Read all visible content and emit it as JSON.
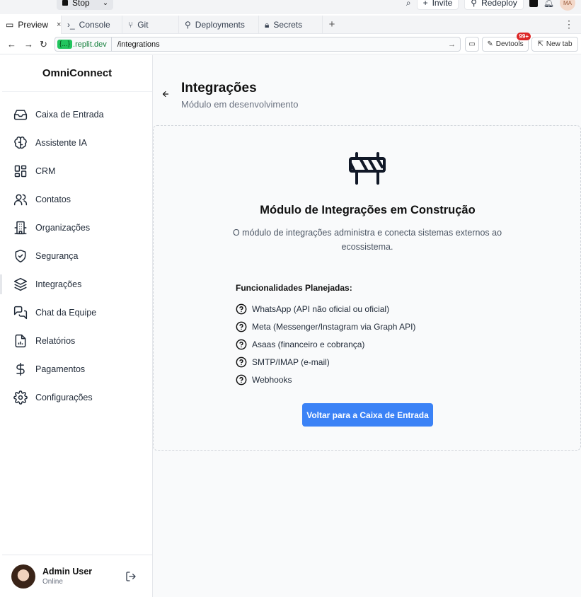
{
  "replit": {
    "stop_label": "Stop",
    "invite_label": "Invite",
    "redeploy_label": "Redeploy",
    "avatar_initials": "MA"
  },
  "tabs": [
    {
      "label": "Preview",
      "icon": "monitor-icon"
    },
    {
      "label": "Console",
      "icon": "terminal-icon"
    },
    {
      "label": "Git",
      "icon": "git-icon"
    },
    {
      "label": "Deployments",
      "icon": "deploy-icon"
    },
    {
      "label": "Secrets",
      "icon": "lock-icon"
    }
  ],
  "urlbar": {
    "domain_badge": "{...}",
    "domain": ".replit.dev",
    "path": "/integrations",
    "devtools_label": "Devtools",
    "devtools_badge": "99+",
    "newtab_label": "New tab"
  },
  "sidebar": {
    "brand": "OmniConnect",
    "items": [
      {
        "label": "Caixa de Entrada",
        "icon": "inbox-icon"
      },
      {
        "label": "Assistente IA",
        "icon": "brain-icon"
      },
      {
        "label": "CRM",
        "icon": "layout-grid-icon"
      },
      {
        "label": "Contatos",
        "icon": "users-icon"
      },
      {
        "label": "Organizações",
        "icon": "building-icon"
      },
      {
        "label": "Segurança",
        "icon": "shield-check-icon"
      },
      {
        "label": "Integrações",
        "icon": "layers-icon"
      },
      {
        "label": "Chat da Equipe",
        "icon": "messages-icon"
      },
      {
        "label": "Relatórios",
        "icon": "report-icon"
      },
      {
        "label": "Pagamentos",
        "icon": "dollar-icon"
      },
      {
        "label": "Configurações",
        "icon": "settings-icon"
      }
    ],
    "active_index": 6,
    "user": {
      "name": "Admin User",
      "status": "Online"
    }
  },
  "main": {
    "title": "Integrações",
    "subtitle": "Módulo em desenvolvimento",
    "card": {
      "icon": "construction-icon",
      "title": "Módulo de Integrações em Construção",
      "description": "O módulo de integrações administra e conecta sistemas externos ao ecossistema.",
      "features_title": "Funcionalidades Planejadas:",
      "features": [
        "WhatsApp (API não oficial ou oficial)",
        "Meta (Messenger/Instagram via Graph API)",
        "Asaas (financeiro e cobrança)",
        "SMTP/IMAP (e-mail)",
        "Webhooks"
      ],
      "cta": "Voltar para a Caixa de Entrada"
    }
  },
  "colors": {
    "accent": "#3b82f6",
    "sidebar_bg": "#ffffff",
    "main_bg": "#f9fafb"
  }
}
